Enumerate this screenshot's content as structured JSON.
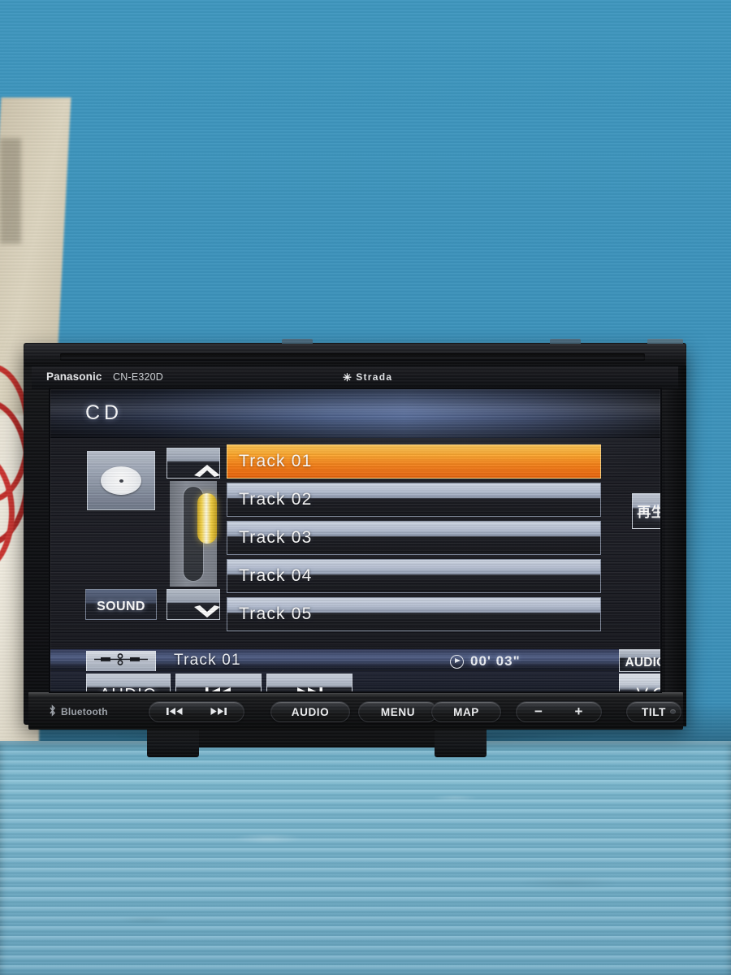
{
  "device": {
    "brand": "Panasonic",
    "model": "CN-E320D",
    "series_logo": "Strada",
    "series_star_icon": "star-icon",
    "bluetooth_label": "Bluetooth",
    "bluetooth_icon": "bluetooth-icon"
  },
  "screen": {
    "source_label": "CD",
    "disc_button_icon": "disc-icon",
    "sound_button": "SOUND",
    "scroll_up_icon": "chevron-up-icon",
    "scroll_down_icon": "chevron-down-icon",
    "play_mode_button": "再生モード",
    "tracks": [
      {
        "label": "Track 01",
        "selected": true
      },
      {
        "label": "Track 02",
        "selected": false
      },
      {
        "label": "Track 03",
        "selected": false
      },
      {
        "label": "Track 04",
        "selected": false
      },
      {
        "label": "Track 05",
        "selected": false
      }
    ],
    "now_playing": {
      "eq_button_icon": "equalizer-icon",
      "title": "Track 01",
      "play_state_icon": "play-circle-icon",
      "elapsed_time": "00' 03\""
    },
    "controls": {
      "audio_button": "AUDIO",
      "prev_button_icon": "skip-previous-icon",
      "next_button_icon": "skip-next-icon",
      "audio_off_button": "AUDIO OFF",
      "vol_button": "VOL"
    }
  },
  "hardware_buttons": {
    "skip_prev_icon": "skip-previous-icon",
    "skip_next_icon": "skip-next-icon",
    "audio": "AUDIO",
    "menu": "MENU",
    "map": "MAP",
    "volume_down": "−",
    "volume_up": "+",
    "tilt": "TILT",
    "ir_sensor_icon": "ir-sensor-icon"
  },
  "colors": {
    "selected_track": "#fb8a17",
    "scroll_thumb": "#f5d44a",
    "screen_header_blue": "#43598a",
    "backdrop_blue": "#3d93bc",
    "bench_blue": "#76b5cf",
    "wire_red": "#c4302b"
  }
}
